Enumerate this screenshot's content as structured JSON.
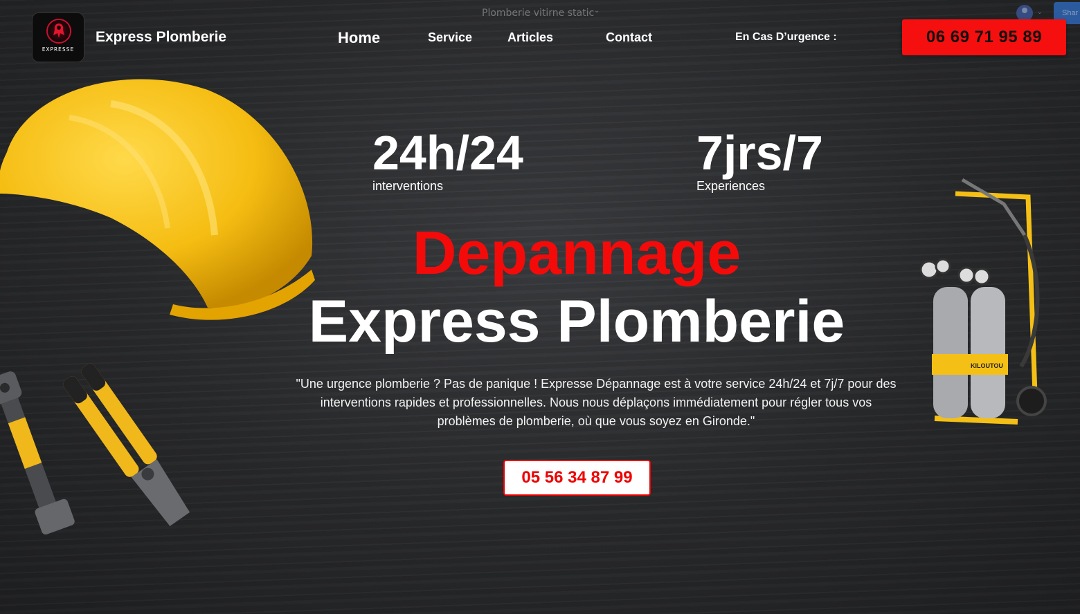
{
  "editor": {
    "page_title": "Plomberie vitirne static",
    "share_label": "Shar"
  },
  "header": {
    "logo_text": "EXPRESSE",
    "brand": "Express Plomberie",
    "nav": {
      "home": "Home",
      "service": "Service",
      "articles": "Articles",
      "contact": "Contact"
    },
    "urgence_label": "En Cas D’urgence :",
    "urgence_phone": "06 69 71 95 89"
  },
  "stats": [
    {
      "value": "24h/24",
      "label": "interventions"
    },
    {
      "value": "7jrs/7",
      "label": "Experiences"
    }
  ],
  "hero": {
    "title_red": "Depannage",
    "title_white": "Express Plomberie",
    "description": "\"Une urgence plomberie ? Pas de panique ! Expresse Dépannage est à votre service 24h/24 et 7j/7 pour des interventions rapides et professionnelles. Nous nous déplaçons immédiatement pour régler tous vos problèmes de plomberie, où que vous soyez en Gironde.\"",
    "phone": "05 56 34 87 99"
  },
  "images": {
    "torch_brand": "KILOUTOU"
  },
  "colors": {
    "accent_red": "#f50f0f",
    "helmet_yellow": "#f7c21a",
    "background": "#2a2b2d"
  }
}
